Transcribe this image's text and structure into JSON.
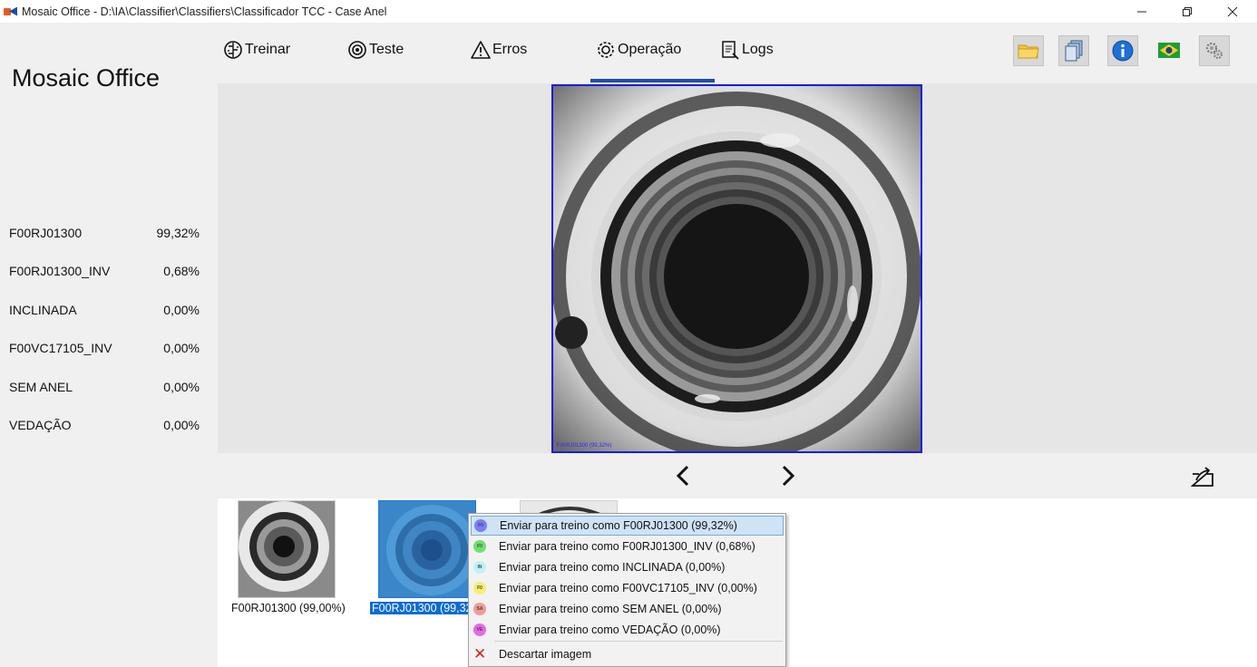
{
  "window": {
    "title": "Mosaic Office - D:\\IA\\Classifier\\Classifiers\\Classificador TCC - Case Anel",
    "minimize_icon": "minimize-icon",
    "restore_icon": "restore-icon",
    "close_icon": "close-icon"
  },
  "brand": "Mosaic Office",
  "classes": [
    {
      "name": "F00RJ01300",
      "pct": "99,32%"
    },
    {
      "name": "F00RJ01300_INV",
      "pct": "0,68%"
    },
    {
      "name": "INCLINADA",
      "pct": "0,00%"
    },
    {
      "name": "F00VC17105_INV",
      "pct": "0,00%"
    },
    {
      "name": "SEM ANEL",
      "pct": "0,00%"
    },
    {
      "name": "VEDAÇÃO",
      "pct": "0,00%"
    }
  ],
  "nav": {
    "items": [
      {
        "label": "Treinar",
        "icon": "brain-icon"
      },
      {
        "label": "Teste",
        "icon": "gear-head-icon"
      },
      {
        "label": "Erros",
        "icon": "warning-icon"
      },
      {
        "label": "Operação",
        "icon": "operation-gear-icon"
      },
      {
        "label": "Logs",
        "icon": "logs-icon"
      }
    ],
    "active": "Operação"
  },
  "toolbar": {
    "buttons": [
      "folder-icon",
      "copy-documents-icon",
      "info-icon",
      "brazil-flag-icon",
      "settings-gears-icon"
    ],
    "accent": "#1e4ea8"
  },
  "viewer": {
    "caption": "F00RJ01300 (99,32%)"
  },
  "navbar": {
    "prev_icon": "chevron-left-icon",
    "next_icon": "chevron-right-icon",
    "export_icon": "export-icon"
  },
  "thumbnails": [
    {
      "label": "F00RJ01300 (99,00%)",
      "selected": false
    },
    {
      "label": "F00RJ01300 (99,32",
      "selected": true
    }
  ],
  "context_menu": {
    "items": [
      {
        "label": "Enviar para treino como F00RJ01300 (99,32%)",
        "badge": "F0",
        "color": "#7b7bff"
      },
      {
        "label": "Enviar para treino como F00RJ01300_INV (0,68%)",
        "badge": "F0",
        "color": "#6fe06f"
      },
      {
        "label": "Enviar para treino como INCLINADA (0,00%)",
        "badge": "IN",
        "color": "#bff2f5"
      },
      {
        "label": "Enviar para treino como F00VC17105_INV (0,00%)",
        "badge": "F0",
        "color": "#f5ee72"
      },
      {
        "label": "Enviar para treino como SEM ANEL (0,00%)",
        "badge": "SA",
        "color": "#f29a9a"
      },
      {
        "label": "Enviar para treino como VEDAÇÃO (0,00%)",
        "badge": "VE",
        "color": "#e569e5"
      }
    ],
    "discard": {
      "label": "Descartar imagem",
      "icon": "discard-x-icon"
    }
  }
}
